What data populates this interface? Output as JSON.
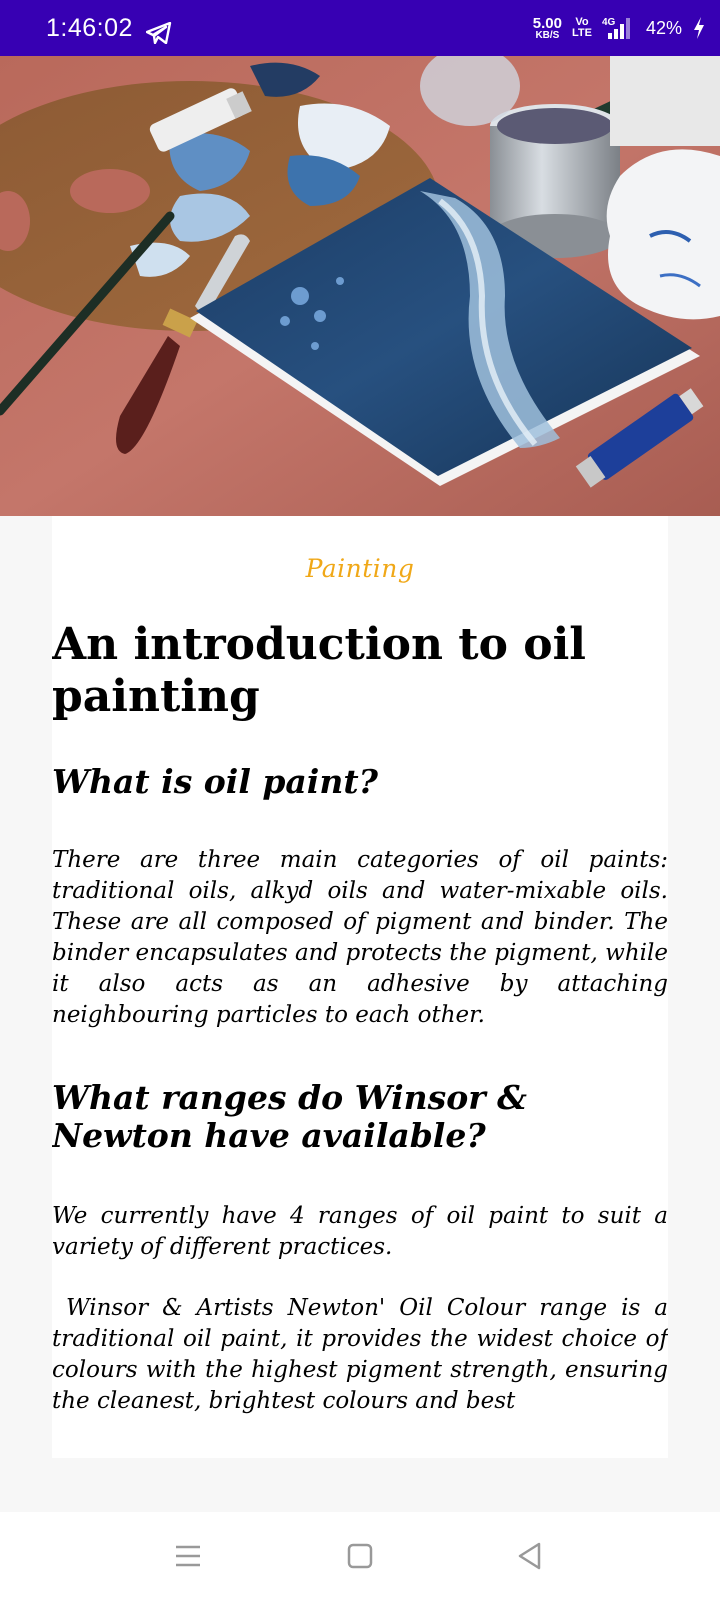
{
  "status_bar": {
    "time": "1:46:02",
    "net_speed_value": "5.00",
    "net_speed_unit": "KB/S",
    "volte_top": "Vo",
    "volte_bottom": "LTE",
    "network_type": "4G",
    "battery": "42%",
    "background_color": "#3700b3",
    "icons": [
      "telegram-icon",
      "signal-icon",
      "charging-bolt-icon"
    ]
  },
  "hero_image": {
    "icon": "oil-painting-canvas-photo"
  },
  "article": {
    "category": "Painting",
    "category_color": "#f0a818",
    "title": "An introduction to oil painting",
    "section1_heading": "What is oil paint?",
    "section1_body": "There are three main categories of oil paints: traditional oils, alkyd oils and water-mixable oils. These are all composed of pigment and binder. The binder encapsulates and protects the pigment, while it also acts as an adhesive by attaching neighbouring particles to each other.",
    "section2_heading": "What ranges do Winsor & Newton have available?",
    "section2_body": "We currently have 4 ranges of oil paint to suit a variety of different practices.",
    "section2_body2": " Winsor & Artists Newton' Oil Colour range is a traditional oil paint, it provides the widest choice of colours with the highest pigment strength, ensuring the cleanest, brightest colours and best"
  },
  "nav_bar": {
    "icons": [
      "recents-menu-icon",
      "home-square-icon",
      "back-triangle-icon"
    ]
  }
}
